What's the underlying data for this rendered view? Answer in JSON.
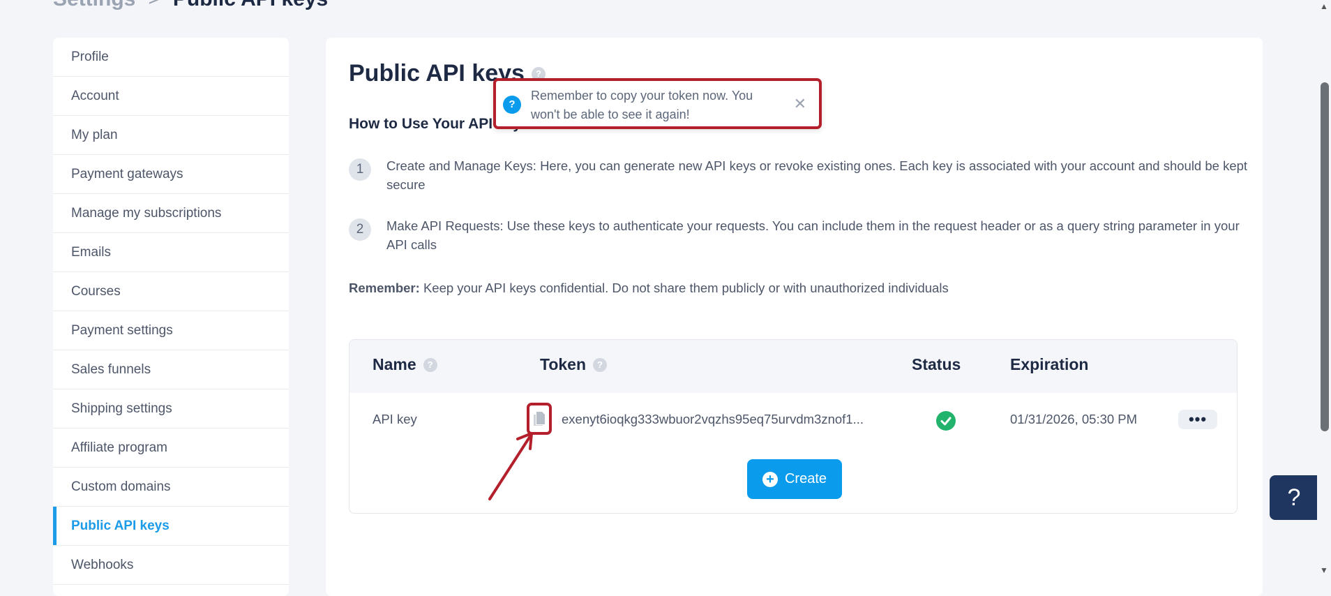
{
  "breadcrumb": {
    "root": "Settings",
    "separator": ">",
    "current": "Public API keys"
  },
  "sidebar": {
    "items": [
      {
        "label": "Profile"
      },
      {
        "label": "Account"
      },
      {
        "label": "My plan"
      },
      {
        "label": "Payment gateways"
      },
      {
        "label": "Manage my subscriptions"
      },
      {
        "label": "Emails"
      },
      {
        "label": "Courses"
      },
      {
        "label": "Payment settings"
      },
      {
        "label": "Sales funnels"
      },
      {
        "label": "Shipping settings"
      },
      {
        "label": "Affiliate program"
      },
      {
        "label": "Custom domains"
      },
      {
        "label": "Public API keys",
        "active": true
      },
      {
        "label": "Webhooks"
      }
    ]
  },
  "main": {
    "title": "Public API keys",
    "how_to_title": "How to Use Your API keys",
    "steps": [
      {
        "num": "1",
        "text": "Create and Manage Keys: Here, you can generate new API keys or revoke existing ones. Each key is associated with your account and should be kept secure"
      },
      {
        "num": "2",
        "text": "Make API Requests: Use these keys to authenticate your requests. You can include them in the request header or as a query string parameter in your API calls"
      }
    ],
    "remember_label": "Remember:",
    "remember_text": "Keep your API keys confidential. Do not share them publicly or with unauthorized individuals"
  },
  "table": {
    "headers": {
      "name": "Name",
      "token": "Token",
      "status": "Status",
      "expiration": "Expiration"
    },
    "rows": [
      {
        "name": "API key",
        "token": "exenyt6ioqkg333wbuor2vqzhs95eq75urvdm3znof1...",
        "status": "active",
        "expiration": "01/31/2026, 05:30 PM",
        "more": "•••"
      }
    ],
    "create_label": "Create"
  },
  "toast": {
    "icon": "?",
    "message": "Remember to copy your token now. You won't be able to see it again!",
    "close": "✕"
  },
  "help_widget": {
    "label": "?"
  },
  "colors": {
    "accent": "#0a9bec",
    "annotation": "#b3202b",
    "success": "#21b36b",
    "heading": "#1e2a44"
  }
}
